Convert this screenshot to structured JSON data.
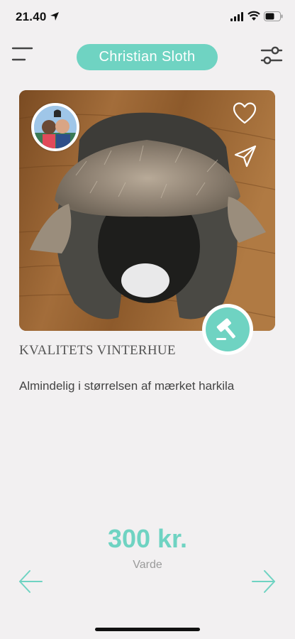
{
  "status_bar": {
    "time": "21.40"
  },
  "header": {
    "user_name": "Christian  Sloth"
  },
  "listing": {
    "title": "KVALITETS VINTERHUE",
    "description": "Almindelig i størrelsen af mærket harkila",
    "price": "300 kr.",
    "location": "Varde"
  },
  "icons": {
    "menu": "menu-icon",
    "filter": "sliders-icon",
    "like": "heart-icon",
    "share": "send-icon",
    "bid": "gavel-icon",
    "previous": "arrow-left-icon",
    "next": "arrow-right-icon"
  },
  "colors": {
    "accent": "#6fd3c2",
    "background": "#f2f0f1",
    "muted": "#9a9a9a"
  }
}
